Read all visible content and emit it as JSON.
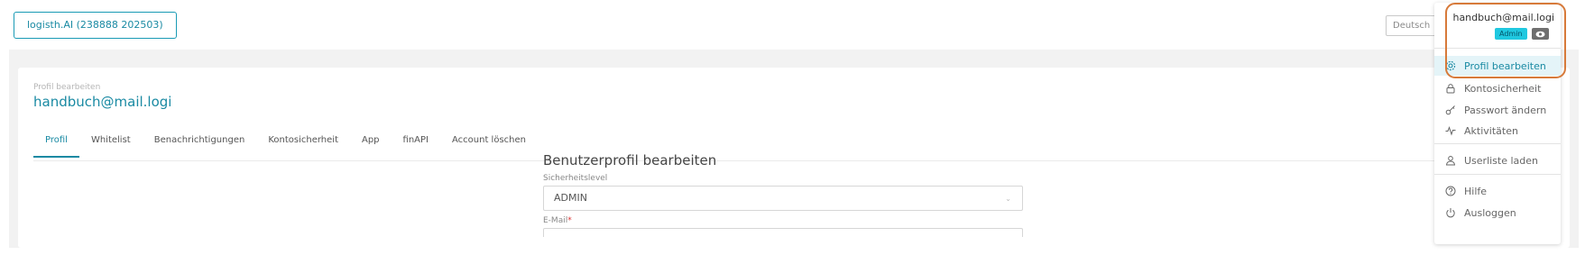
{
  "header": {
    "company_button": "logisth.AI (238888 202503)",
    "language": "Deutsch"
  },
  "page": {
    "breadcrumb": "Profil bearbeiten",
    "title": "handbuch@mail.logi",
    "tabs": [
      {
        "label": "Profil",
        "active": true
      },
      {
        "label": "Whitelist"
      },
      {
        "label": "Benachrichtigungen"
      },
      {
        "label": "Kontosicherheit"
      },
      {
        "label": "App"
      },
      {
        "label": "finAPI"
      },
      {
        "label": "Account löschen"
      }
    ]
  },
  "form": {
    "title": "Benutzerprofil bearbeiten",
    "security_label": "Sicherheitslevel",
    "security_value": "ADMIN",
    "email_label": "E-Mail",
    "email_required": "*"
  },
  "user_menu": {
    "email": "handbuch@mail.logi",
    "role_badge": "Admin",
    "items": [
      {
        "label": "Profil bearbeiten",
        "icon": "gear-icon",
        "active": true
      },
      {
        "label": "Kontosicherheit",
        "icon": "lock-icon"
      },
      {
        "label": "Passwort ändern",
        "icon": "key-icon"
      },
      {
        "label": "Aktivitäten",
        "icon": "activity-icon"
      },
      {
        "label": "Userliste laden",
        "icon": "user-icon"
      },
      {
        "label": "Hilfe",
        "icon": "help-icon"
      },
      {
        "label": "Ausloggen",
        "icon": "power-icon"
      }
    ]
  },
  "colors": {
    "accent": "#1a8aa3",
    "badge": "#1fc8e0",
    "highlight": "#d77a3a"
  }
}
